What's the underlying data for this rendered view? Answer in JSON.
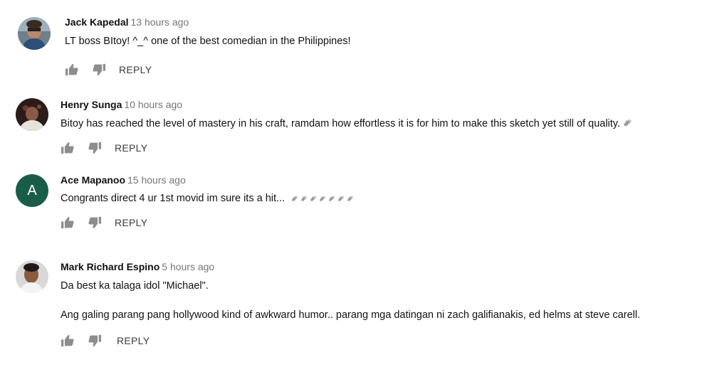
{
  "comments": [
    {
      "author": "Jack Kapedal",
      "time": "13 hours ago",
      "text": "LT boss BItoy! ^_^ one of the best comedian in the Philippines!",
      "reply_label": "REPLY",
      "avatar_icon": "user-photo"
    },
    {
      "author": "Henry Sunga",
      "time": "10 hours ago",
      "text": "Bitoy has reached the level of mastery in his craft, ramdam how effortless it is for him to make this sketch yet still of quality.",
      "reply_label": "REPLY",
      "avatar_icon": "user-photo",
      "trailing_emoji": "clap-emoji"
    },
    {
      "author": "Ace Mapanoo",
      "time": "15 hours ago",
      "text": "Congrants direct 4 ur 1st movid im sure its a hit...",
      "reply_label": "REPLY",
      "avatar_letter": "A",
      "avatar_color": "#1a5c4a",
      "trailing_emoji": "clap-emoji"
    },
    {
      "author": "Mark Richard Espino",
      "time": "5 hours ago",
      "text": "Da best ka talaga idol \"Michael\".",
      "text2": "Ang galing parang pang hollywood kind of awkward humor.. parang mga datingan ni zach galifianakis, ed helms at steve carell.",
      "reply_label": "REPLY",
      "avatar_icon": "user-photo"
    }
  ],
  "colors": {
    "author": "#111111",
    "timestamp": "#767676",
    "icon": "#909090",
    "reply": "#3c3c3c"
  },
  "icons": {
    "like": "thumbs-up-icon",
    "dislike": "thumbs-down-icon"
  }
}
